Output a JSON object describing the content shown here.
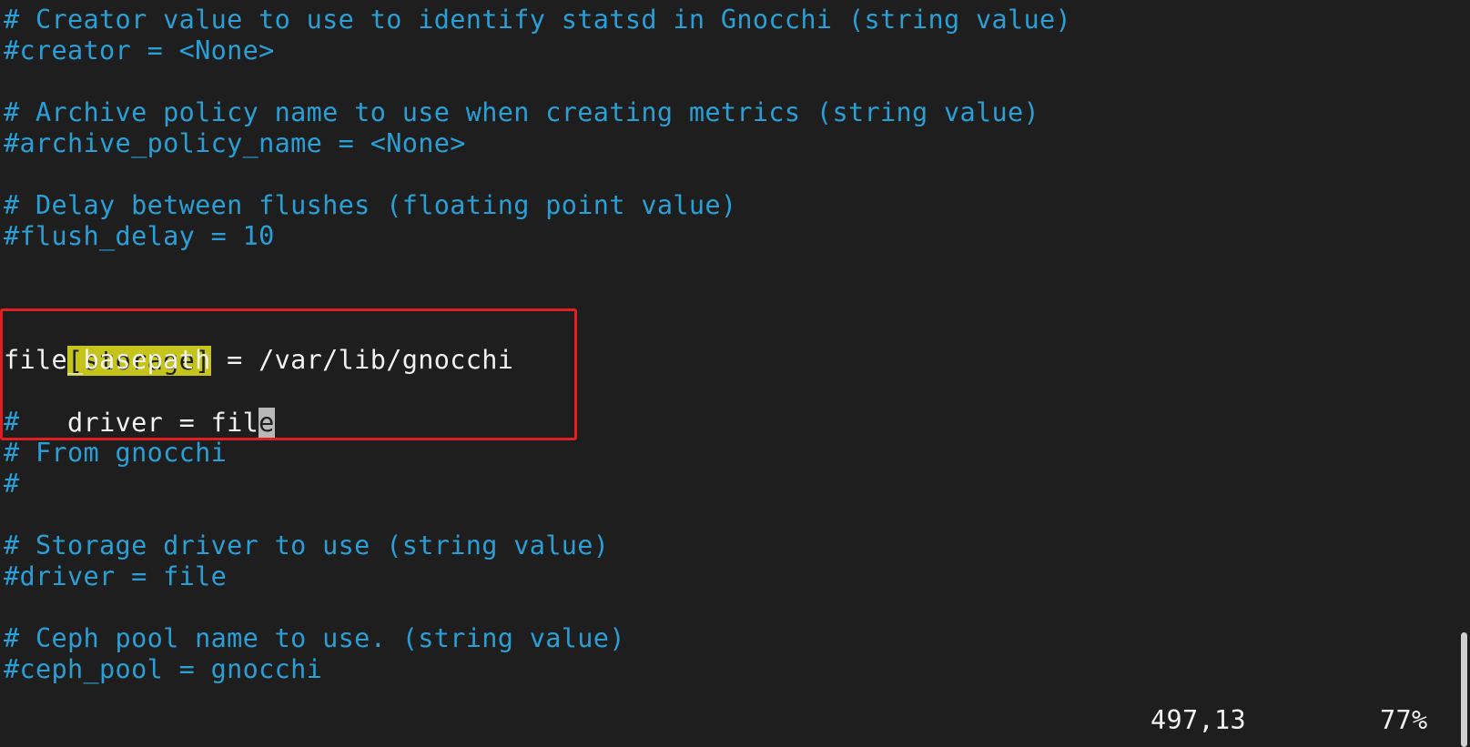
{
  "editor": {
    "lines": [
      {
        "id": "l1",
        "text": "# Creator value to use to identify statsd in Gnocchi (string value)",
        "kind": "comment"
      },
      {
        "id": "l2",
        "text": "#creator = <None>",
        "kind": "comment"
      },
      {
        "id": "l3",
        "text": "",
        "kind": "blank"
      },
      {
        "id": "l4",
        "text": "# Archive policy name to use when creating metrics (string value)",
        "kind": "comment"
      },
      {
        "id": "l5",
        "text": "#archive_policy_name = <None>",
        "kind": "comment"
      },
      {
        "id": "l6",
        "text": "",
        "kind": "blank"
      },
      {
        "id": "l7",
        "text": "# Delay between flushes (floating point value)",
        "kind": "comment"
      },
      {
        "id": "l8",
        "text": "#flush_delay = 10",
        "kind": "comment"
      }
    ],
    "storage_block": {
      "section_header": "[storage]",
      "file_basepath_line": "file_basepath = /var/lib/gnocchi",
      "driver_prefix": "driver = fil",
      "cursor_char": "e",
      "hash_line": "#"
    },
    "lines_after": [
      {
        "id": "a1",
        "text": "# From gnocchi",
        "kind": "comment"
      },
      {
        "id": "a2",
        "text": "#",
        "kind": "comment"
      },
      {
        "id": "a3",
        "text": "",
        "kind": "blank"
      },
      {
        "id": "a4",
        "text": "# Storage driver to use (string value)",
        "kind": "comment"
      },
      {
        "id": "a5",
        "text": "#driver = file",
        "kind": "comment"
      },
      {
        "id": "a6",
        "text": "",
        "kind": "blank"
      },
      {
        "id": "a7",
        "text": "# Ceph pool name to use. (string value)",
        "kind": "comment"
      },
      {
        "id": "a8",
        "text": "#ceph_pool = gnocchi",
        "kind": "comment"
      }
    ]
  },
  "status_bar": {
    "position": "497,13",
    "scroll_percent": "77%"
  },
  "colors": {
    "background": "#1e1e1e",
    "comment": "#2a9fd6",
    "text": "#f2f2f2",
    "section_highlight": "#c4c41a",
    "annotation_box": "#e02020"
  }
}
